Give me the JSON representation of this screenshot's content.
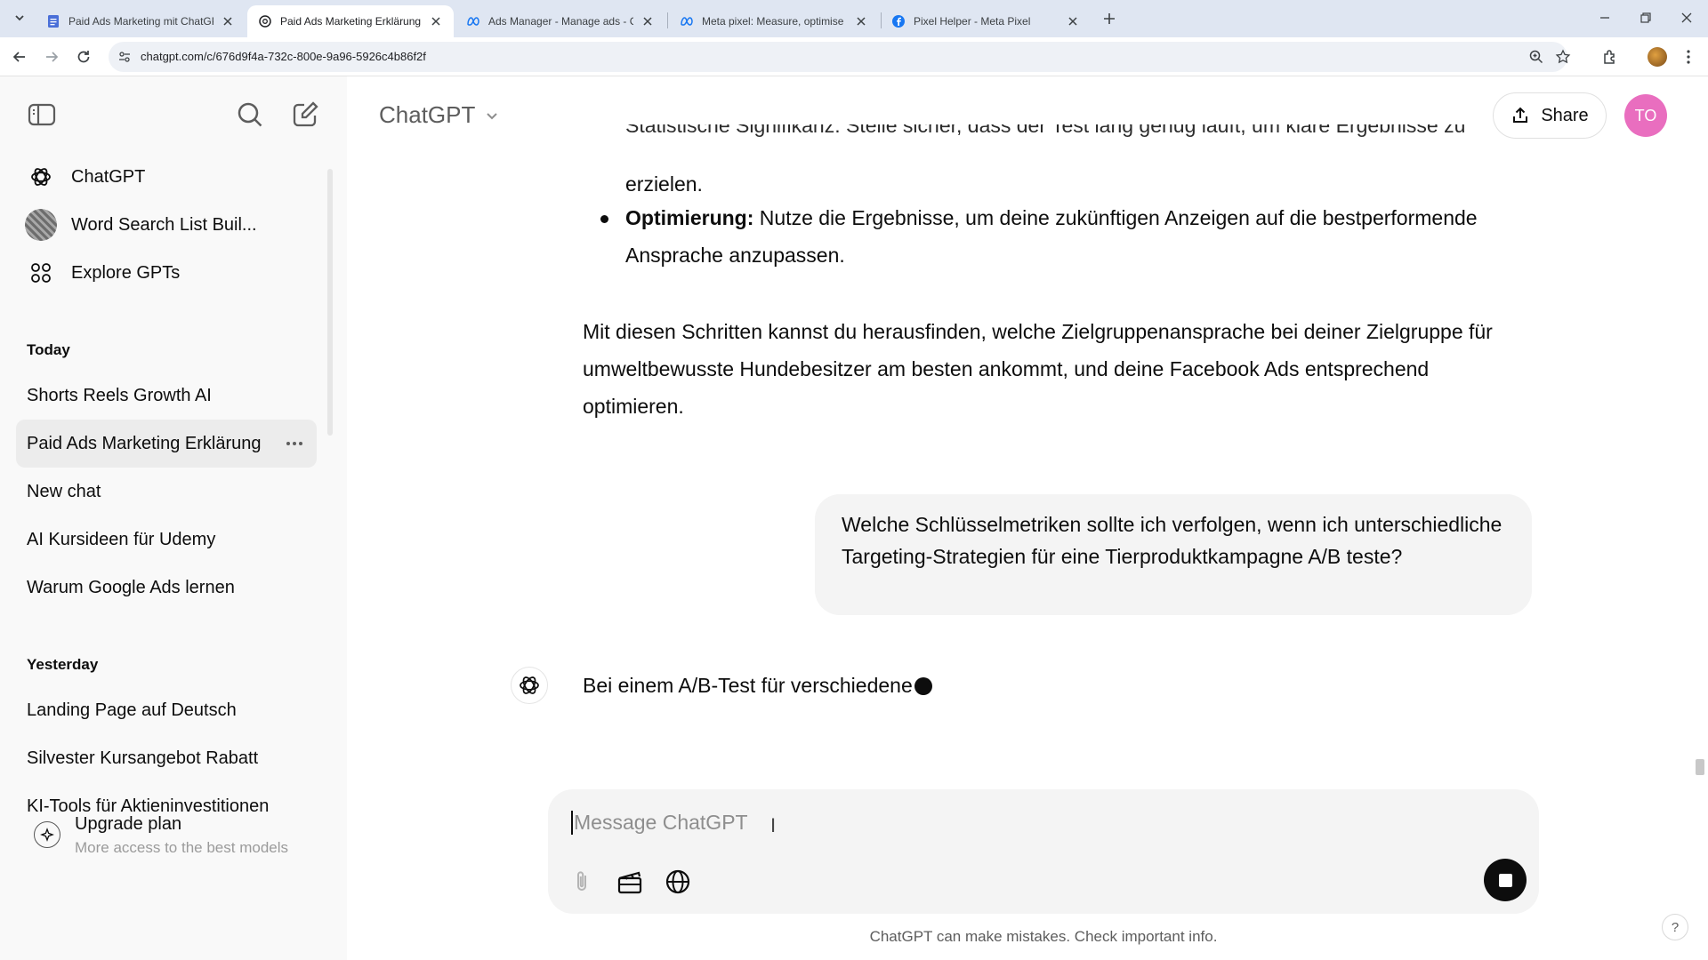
{
  "browser": {
    "tabs": [
      {
        "title": "Paid Ads Marketing mit ChatGPT",
        "icon": "document-icon",
        "active": false
      },
      {
        "title": "Paid Ads Marketing Erklärung",
        "icon": "openai-icon",
        "active": true
      },
      {
        "title": "Ads Manager - Manage ads - C",
        "icon": "meta-icon",
        "active": false
      },
      {
        "title": "Meta pixel: Measure, optimise a",
        "icon": "meta-icon",
        "active": false
      },
      {
        "title": "Pixel Helper - Meta Pixel",
        "icon": "facebook-icon",
        "active": false
      }
    ],
    "url": "chatgpt.com/c/676d9f4a-732c-800e-9a96-5926c4b86f2f"
  },
  "sidebar": {
    "gpts": [
      {
        "label": "ChatGPT",
        "icon": "openai-icon"
      },
      {
        "label": "Word Search List Buil...",
        "icon": "gpt-avatar"
      },
      {
        "label": "Explore GPTs",
        "icon": "grid-icon"
      }
    ],
    "sections": [
      {
        "title": "Today",
        "items": [
          "Shorts Reels Growth AI",
          "Paid Ads Marketing Erklärung",
          "New chat",
          "AI Kursideen für Udemy",
          "Warum Google Ads lernen"
        ]
      },
      {
        "title": "Yesterday",
        "items": [
          "Landing Page auf Deutsch",
          "Silvester Kursangebot Rabatt",
          "KI-Tools für Aktieninvestitionen"
        ]
      }
    ],
    "upgrade": {
      "title": "Upgrade plan",
      "subtitle": "More access to the best models"
    }
  },
  "header": {
    "model": "ChatGPT",
    "share_label": "Share",
    "avatar_initials": "TO"
  },
  "conversation": {
    "cut_line": "Statistische Signifikanz: Stelle sicher, dass der Test lang genug läuft, um klare Ergebnisse zu",
    "cut_line_cont": "erzielen.",
    "bullet_bold": "Optimierung:",
    "bullet_text": " Nutze die Ergebnisse, um deine zukünftigen Anzeigen auf die bestperformende Ansprache anzupassen.",
    "paragraph": "Mit diesen Schritten kannst du herausfinden, welche Zielgruppenansprache bei deiner Zielgruppe für umweltbewusste Hundebesitzer am besten ankommt, und deine Facebook Ads entsprechend optimieren.",
    "user_message": "Welche Schlüsselmetriken sollte ich verfolgen, wenn ich unterschiedliche Targeting-Strategien für eine Tierproduktkampagne A/B teste?",
    "assistant_partial": "Bei einem A/B-Test für verschiedene"
  },
  "composer": {
    "placeholder": "Message ChatGPT",
    "tools": [
      "attach-icon",
      "video-icon",
      "globe-icon"
    ]
  },
  "footer": {
    "disclaimer": "ChatGPT can make mistakes. Check important info.",
    "help": "?"
  },
  "colors": {
    "avatar": "#e96ebf",
    "sidebar_bg": "#f9f9f9",
    "bubble_bg": "#f4f4f4",
    "tabbar_bg": "#dfe6f2"
  }
}
